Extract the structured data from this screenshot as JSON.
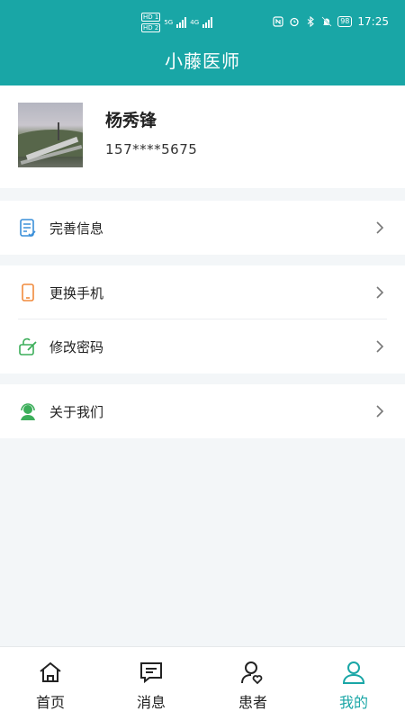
{
  "statusbar": {
    "hd1": "HD 1",
    "hd2": "HD 2",
    "net1": "5G",
    "net2": "4G",
    "battery": "98",
    "time": "17:25"
  },
  "header": {
    "title": "小藤医师"
  },
  "profile": {
    "name": "杨秀锋",
    "phone": "157****5675"
  },
  "menu": {
    "complete_info": "完善信息",
    "change_phone": "更换手机",
    "change_password": "修改密码",
    "about_us": "关于我们"
  },
  "tabs": [
    {
      "label": "首页",
      "icon": "home-icon"
    },
    {
      "label": "消息",
      "icon": "message-icon"
    },
    {
      "label": "患者",
      "icon": "patient-icon"
    },
    {
      "label": "我的",
      "icon": "profile-icon"
    }
  ],
  "colors": {
    "primary": "#19a6a6",
    "active_tab": "#19a6a6",
    "background": "#f3f6f8"
  },
  "active_tab": "我的"
}
